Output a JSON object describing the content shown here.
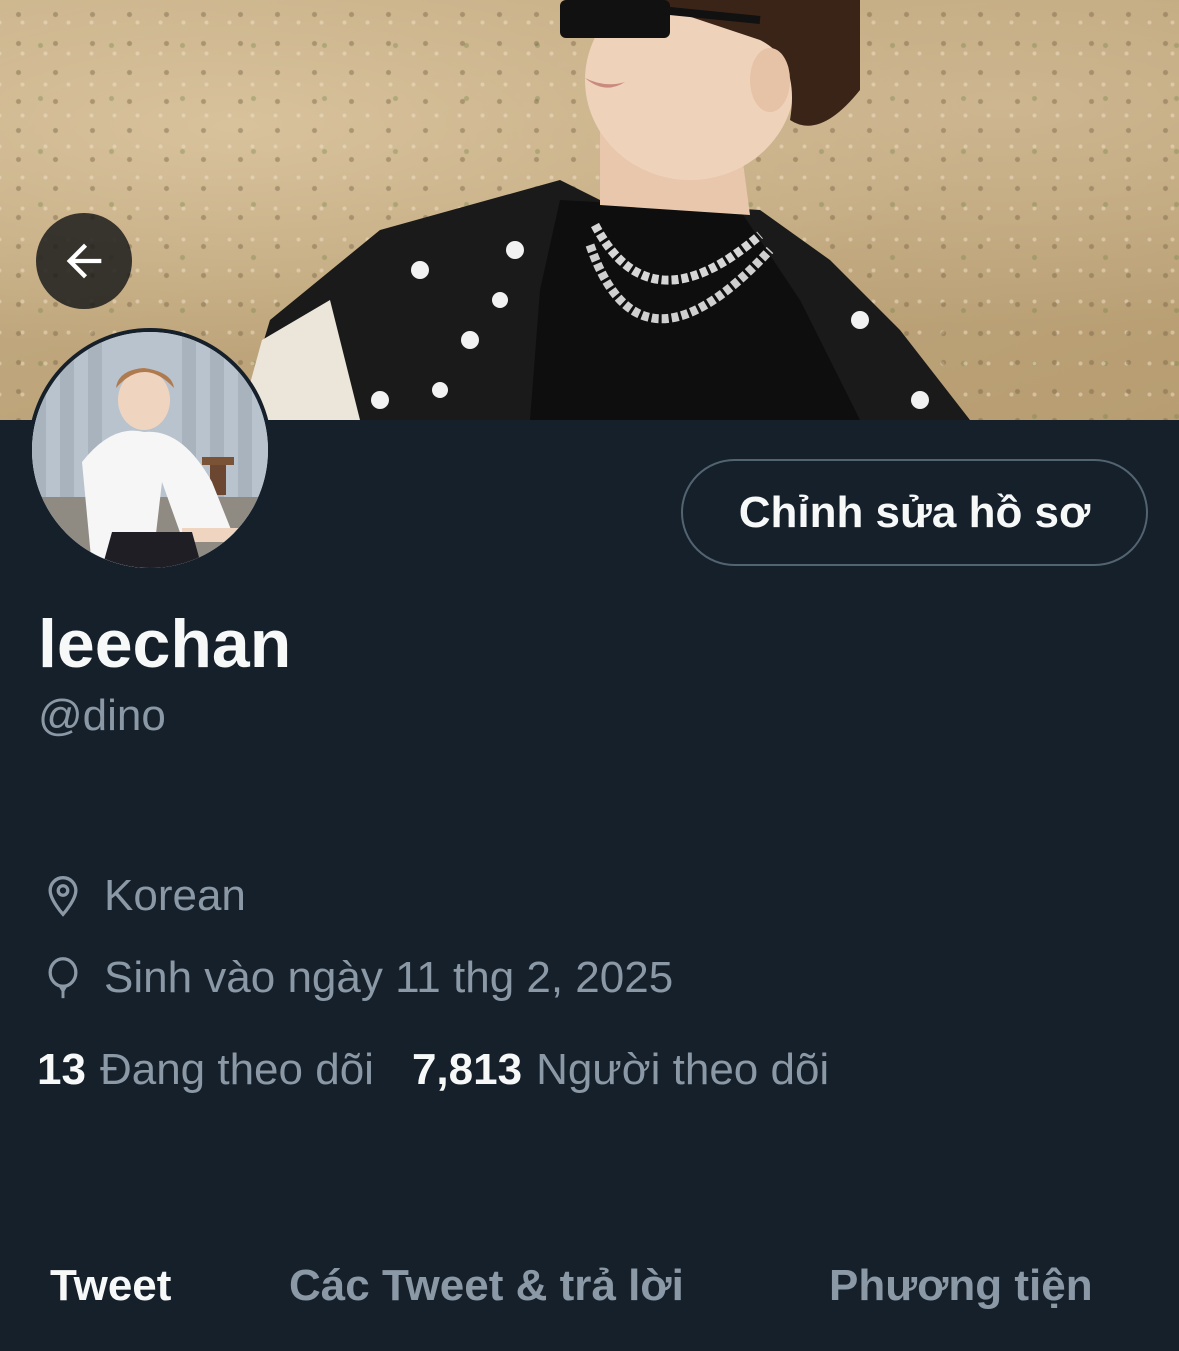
{
  "profile": {
    "name": "leechan",
    "handle": "@dino",
    "location": "Korean",
    "birthday": "Sinh vào ngày 11 thg 2, 2025",
    "edit_button_label": "Chỉnh sửa hồ sơ"
  },
  "stats": {
    "following_count": "13",
    "following_label": "Đang theo dõi",
    "followers_count": "7,813",
    "followers_label": "Người theo dõi"
  },
  "tabs": [
    {
      "label": "Tweet",
      "active": true
    },
    {
      "label": "Các Tweet & trả lời",
      "active": false
    },
    {
      "label": "Phương tiện",
      "active": false
    }
  ],
  "icons": {
    "back": "arrow-left-icon",
    "location": "location-pin-icon",
    "birthday": "balloon-icon"
  },
  "colors": {
    "background": "#15202b",
    "primary_text": "#f7f9f9",
    "secondary_text": "#8b98a5",
    "border": "#536471"
  }
}
